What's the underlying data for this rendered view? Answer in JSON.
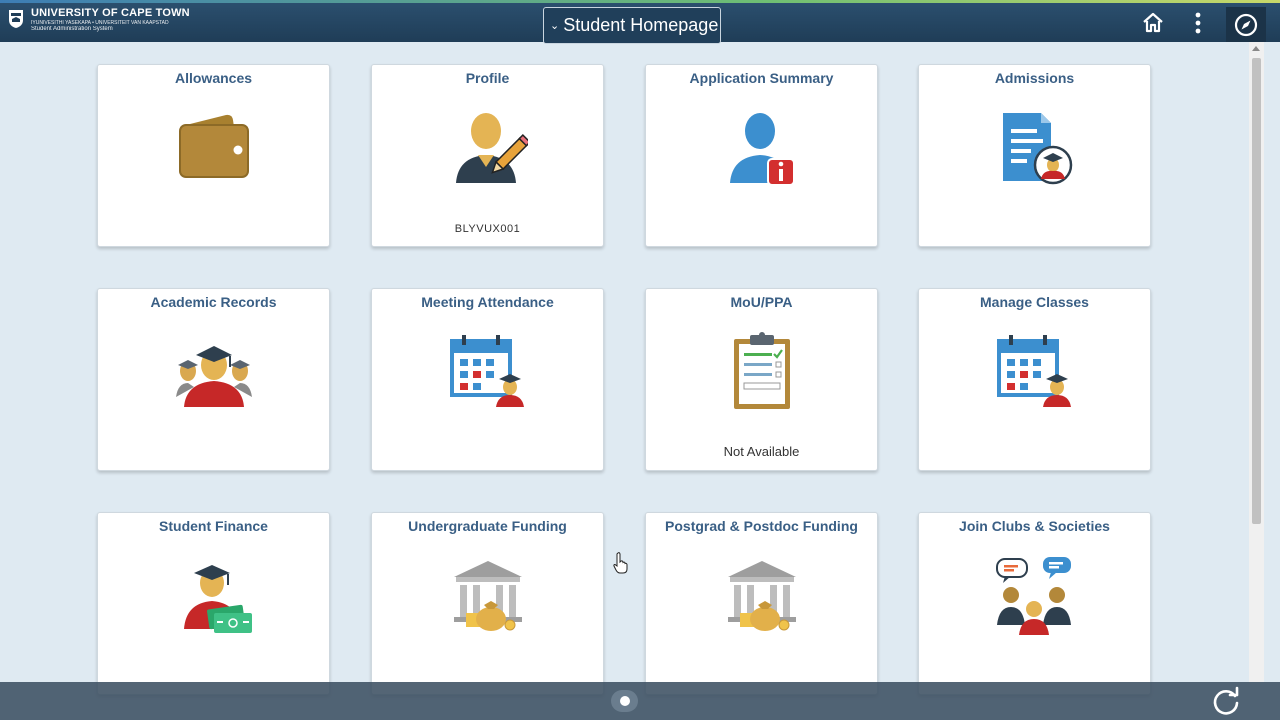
{
  "header": {
    "university_name": "UNIVERSITY OF CAPE TOWN",
    "university_languages": "IYUNIVESITHI YASEKAPA • UNIVERSITEIT VAN KAAPSTAD",
    "system_name": "Student Administration System",
    "page_title": "Student Homepage",
    "icons": {
      "home": "home-icon",
      "actions": "vertical-ellipsis-icon",
      "nav": "compass-icon"
    }
  },
  "tiles": [
    {
      "title": "Allowances",
      "subtitle": "",
      "icon": "wallet-icon"
    },
    {
      "title": "Profile",
      "subtitle": "BLYVUX001",
      "icon": "person-pencil-icon"
    },
    {
      "title": "Application Summary",
      "subtitle": "",
      "icon": "person-info-icon"
    },
    {
      "title": "Admissions",
      "subtitle": "",
      "icon": "document-graduate-icon"
    },
    {
      "title": "Academic Records",
      "subtitle": "",
      "icon": "graduates-group-icon"
    },
    {
      "title": "Meeting Attendance",
      "subtitle": "",
      "icon": "calendar-graduate-icon"
    },
    {
      "title": "MoU/PPA",
      "subtitle": "Not Available",
      "icon": "clipboard-checklist-icon"
    },
    {
      "title": "Manage Classes",
      "subtitle": "",
      "icon": "calendar-graduate-icon"
    },
    {
      "title": "Student Finance",
      "subtitle": "",
      "icon": "graduate-money-icon"
    },
    {
      "title": "Undergraduate Funding",
      "subtitle": "",
      "icon": "bank-moneybag-icon"
    },
    {
      "title": "Postgrad & Postdoc Funding",
      "subtitle": "",
      "icon": "bank-moneybag-icon"
    },
    {
      "title": "Join Clubs & Societies",
      "subtitle": "",
      "icon": "people-chat-icon"
    }
  ],
  "footer": {
    "icons": {
      "pager": "page-indicator-icon",
      "refresh": "refresh-icon"
    }
  },
  "colors": {
    "header": "#1f3d57",
    "tile_title": "#3a5f85",
    "background": "#dfeaf2"
  }
}
